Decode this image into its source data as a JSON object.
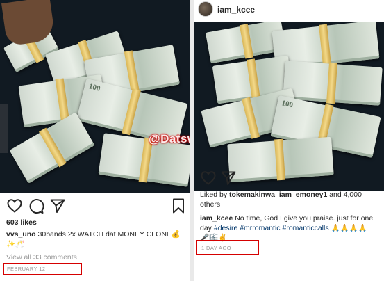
{
  "left_post": {
    "likes": "603 likes",
    "caption_user": "vvs_uno",
    "caption_text": "30bands 2x WATCH dat MONEY CLONE",
    "caption_emoji": "💰",
    "caption_emoji_line2": "✨🥂",
    "comments_link": "View all 33 comments",
    "date": "FEBRUARY 12",
    "watermark": "@Datswasup",
    "banknote_denomination": "100"
  },
  "right_post": {
    "username": "iam_kcee",
    "likes_prefix": "Liked by",
    "liked_by_1": "tokemakinwa",
    "liked_by_sep": ",",
    "liked_by_2": "iam_emoney1",
    "likes_suffix": "and 4,000",
    "likes_suffix2": "others",
    "caption_user": "iam_kcee",
    "caption_text": "No time, God I give you praise. just for one day",
    "hashtags": "#desire #mrromantic #romanticcalls",
    "caption_emoji_end": "🙏🙏🙏🙏",
    "caption_emoji_line2": "🎤🎼✌",
    "date": "1 DAY AGO",
    "banknote_denomination": "100"
  },
  "colors": {
    "highlight_box": "#d50000",
    "hashtag": "#003569",
    "muted": "#999999"
  },
  "icons": [
    "heart-icon",
    "comment-icon",
    "share-icon",
    "bookmark-icon"
  ]
}
